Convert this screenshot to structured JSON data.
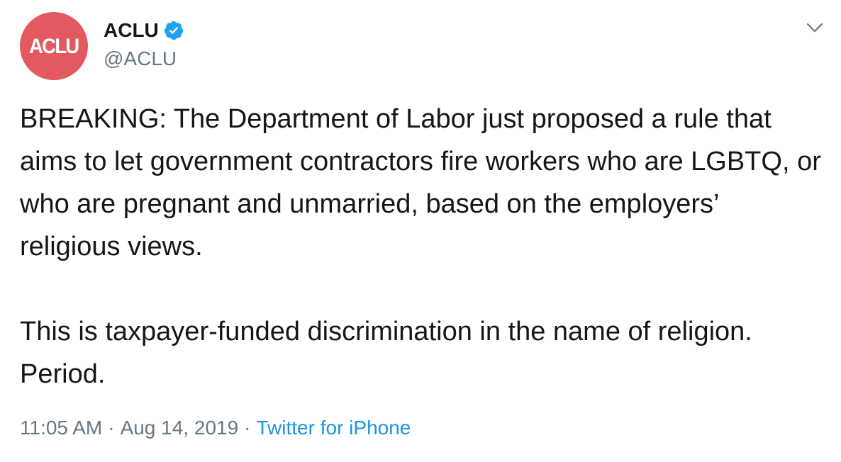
{
  "author": {
    "avatar_text": "ACLU",
    "display_name": "ACLU",
    "handle": "@ACLU",
    "verified": true,
    "verified_icon": "verified-badge-icon"
  },
  "tweet": {
    "paragraphs": [
      "BREAKING: The Department of Labor just proposed a rule that aims to let government contractors fire workers who are LGBTQ, or who are pregnant and unmarried, based on the employers’ religious views.",
      "This is taxpayer-funded discrimination in the name of religion. Period."
    ]
  },
  "meta": {
    "time": "11:05 AM",
    "date": "Aug 14, 2019",
    "separator": "·",
    "source": "Twitter for iPhone"
  },
  "menu": {
    "icon": "chevron-down-icon"
  },
  "colors": {
    "avatar_bg": "#e25a5f",
    "text_primary": "#14171a",
    "text_secondary": "#657786",
    "link": "#1b95e0",
    "verified": "#1da1f2"
  }
}
